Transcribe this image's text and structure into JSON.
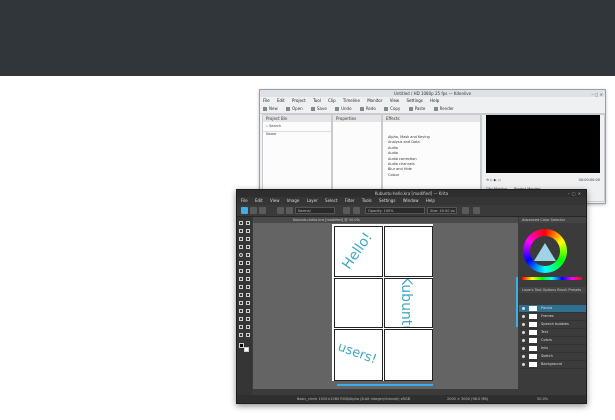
{
  "kdenlive": {
    "title": "Untitled / HD 1080p 25 fps — Kdenlive",
    "menu": [
      "File",
      "Edit",
      "Project",
      "Tool",
      "Clip",
      "Timeline",
      "Monitor",
      "View",
      "Settings",
      "Help"
    ],
    "toolbar": [
      "New",
      "Open",
      "Save",
      "Undo",
      "Redo",
      "Copy",
      "Paste",
      "Render"
    ],
    "bin": {
      "title": "Project Bin",
      "search_placeholder": "Search",
      "column": "Name"
    },
    "properties": {
      "title": "Properties"
    },
    "effects": {
      "title": "Effects",
      "categories": [
        "Alpha, Mask and Keying",
        "Analysis and Data",
        "Audio",
        "Audio",
        "Audio correction",
        "Audio channels",
        "Blur and Hide",
        "Colour"
      ]
    },
    "monitor": {
      "timecode": "00:00:00:00",
      "tabs": [
        "Clip Monitor",
        "Project Monitor"
      ]
    }
  },
  "krita": {
    "title": "Kubuntu-hello.kra [modified] — Krita",
    "menu": [
      "File",
      "Edit",
      "View",
      "Image",
      "Layer",
      "Select",
      "Filter",
      "Tools",
      "Settings",
      "Window",
      "Help"
    ],
    "toolbar": {
      "opacity": "Opacity: 100%",
      "size": "Size: 40.00 px",
      "blend": "Normal"
    },
    "doc_tab": "Kubuntu-hello.kra [modified] @ 50.0%",
    "canvas_text": {
      "hello": "Hello!",
      "kubuntu": "Kubuntu",
      "users": "users!"
    },
    "dockers": {
      "color_title": "Advanced Color Selector",
      "tabs": "Layers  Tool Options  Brush Presets",
      "layers": [
        "Panels",
        "Frames",
        "Speech bubbles",
        "Text",
        "Colors",
        "Inks",
        "Sketch",
        "Background"
      ]
    },
    "status": {
      "left": "Basic_circle 1920×1080 RGB/Alpha (8-bit integer/channel) sRGB",
      "right": "2000 × 3000 (98.0 MB)",
      "zoom": "50.0%"
    }
  }
}
